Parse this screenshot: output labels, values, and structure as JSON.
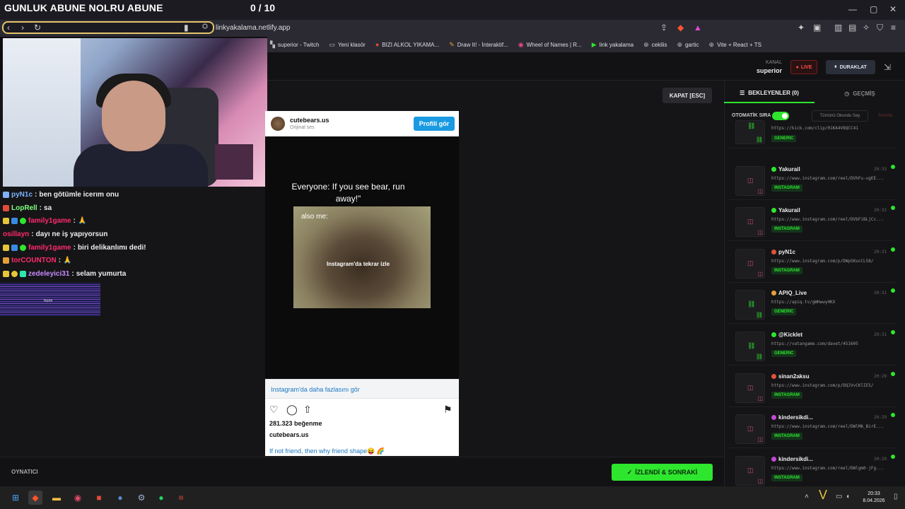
{
  "overlay": {
    "title": "GUNLUK ABUNE NOLRU ABUNE",
    "counter": "0 / 10"
  },
  "browser": {
    "url": "linkyakalama.netlify.app",
    "bookmarks": [
      {
        "label": "superior - Twitch",
        "icon": "twitch-icon"
      },
      {
        "label": "Yeni klasör",
        "icon": "folder-icon"
      },
      {
        "label": "BIZI ALKOL YIKAMA...",
        "icon": "site-icon"
      },
      {
        "label": "Draw It! - İnteraktif...",
        "icon": "site-icon"
      },
      {
        "label": "Wheel of Names | R...",
        "icon": "site-icon"
      },
      {
        "label": "link yakalama",
        "icon": "site-icon"
      },
      {
        "label": "cekilis",
        "icon": "site-icon"
      },
      {
        "label": "gartic",
        "icon": "site-icon"
      },
      {
        "label": "Vite + React + TS",
        "icon": "site-icon"
      }
    ]
  },
  "header": {
    "kanal_label": "KANAL",
    "kanal_value": "superior",
    "live_label": "LIVE",
    "pause_label": "DURAKLAT"
  },
  "stage": {
    "close_label": "KAPAT [ESC]"
  },
  "instagram": {
    "username": "cutebears.us",
    "audio": "Orijinal ses",
    "profile_button": "Profili gör",
    "meme_top": "Everyone: If you see bear, run away!\"",
    "meme_also": "also me:",
    "watch_again": "Instagram'da tekrar izle",
    "more_link": "Instagram'da daha fazlasını gör",
    "likes": "281.323 beğenme",
    "caption_user": "cutebears.us",
    "caption": "If not friend, then why friend shape😝 🌈"
  },
  "chat": [
    {
      "user": "pyN1c",
      "msg": "ben götümle icerım onu",
      "color": "#7fb3ff"
    },
    {
      "user": "LopRell",
      "msg": "sa",
      "color": "#7fff7f"
    },
    {
      "user": "family1game",
      "msg": "🙏",
      "color": "#ff2a6d"
    },
    {
      "user": "osillayn",
      "msg": "dayı ne iş yapıyorsun",
      "color": "#ff2a6d"
    },
    {
      "user": "family1game",
      "msg": "biri delikanlımı dedi!",
      "color": "#ff2a6d"
    },
    {
      "user": "torCOUNTON",
      "msg": "🙏",
      "color": "#ff2a6d"
    },
    {
      "user": "zedeleyici31",
      "msg": "selam yumurta",
      "color": "#c78cff"
    }
  ],
  "banner_text": "North",
  "player": {
    "label": "OYNATICI",
    "next_button": "İZLENDİ & SONRAKİ"
  },
  "panel": {
    "tab_queue": "BEKLEYENLER (0)",
    "tab_history": "GEÇMİŞ",
    "auto_label": "OTOMATİK SIRA",
    "mark_all": "Tümünü Okundu Say",
    "clear": "Temizle",
    "queue": [
      {
        "user": "",
        "time": "",
        "url": "https://kick.com/clip/01KA4V8QCC41",
        "tag": "GENERIC",
        "kind": "gen",
        "dot": ""
      },
      {
        "user": "Yakurail",
        "time": "20:33",
        "url": "https://www.instagram.com/reel/DVhFu-ugEE...",
        "tag": "INSTAGRAM",
        "kind": "ig",
        "dot": "#2ee62e"
      },
      {
        "user": "Yakurail",
        "time": "20:32",
        "url": "https://www.instagram.com/reel/DVbFiBLjCc...",
        "tag": "INSTAGRAM",
        "kind": "ig",
        "dot": "#2ee62e"
      },
      {
        "user": "pyN1c",
        "time": "20:31",
        "url": "https://www.instagram.com/p/DWpSKucCL58/",
        "tag": "INSTAGRAM",
        "kind": "ig",
        "dot": "#e0523a"
      },
      {
        "user": "APIQ_Live",
        "time": "20:31",
        "url": "https://apiq.tv/gWHwwyHKX",
        "tag": "GENERIC",
        "kind": "gen",
        "dot": "#e5a03a"
      },
      {
        "user": "@Kicklet",
        "time": "20:31",
        "url": "https://vatangame.com/davet/451605",
        "tag": "GENERIC",
        "kind": "gen",
        "dot": "#2ee62e"
      },
      {
        "user": "sinan2aksu",
        "time": "20:29",
        "url": "https://www.instagram.com/p/DQJVvCKlIE5/",
        "tag": "INSTAGRAM",
        "kind": "ig",
        "dot": "#e0523a"
      },
      {
        "user": "kindersikdi...",
        "time": "20:29",
        "url": "https://www.instagram.com/reel/DWlMA_BirE...",
        "tag": "INSTAGRAM",
        "kind": "ig",
        "dot": "#c04ad0"
      },
      {
        "user": "kindersikdi...",
        "time": "20:29",
        "url": "https://www.instagram.com/reel/DWlgm0-jFg...",
        "tag": "INSTAGRAM",
        "kind": "ig",
        "dot": "#c04ad0"
      }
    ]
  },
  "taskbar": {
    "time": "20:33",
    "date": "8.04.2026"
  }
}
